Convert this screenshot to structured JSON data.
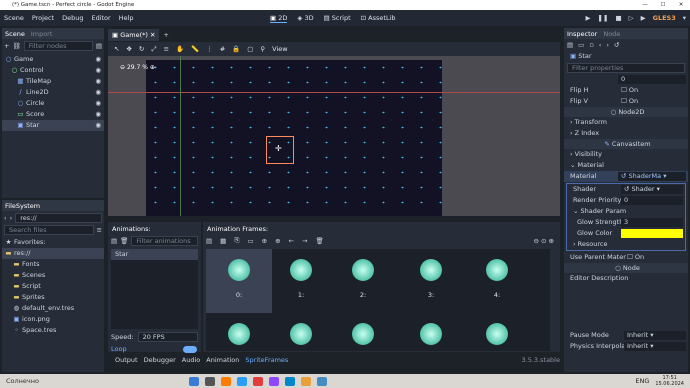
{
  "title": "(*) Game.tscn - Perfect circle - Godot Engine",
  "menu": [
    "Scene",
    "Project",
    "Debug",
    "Editor",
    "Help"
  ],
  "workspaces": [
    "2D",
    "3D",
    "Script",
    "AssetLib"
  ],
  "renderer": "GLES3",
  "scene_dock": {
    "tabs": [
      "Scene",
      "Import"
    ],
    "filter_placeholder": "Filter nodes",
    "nodes": [
      {
        "name": "Game",
        "depth": 0,
        "icon": "node2d-icon"
      },
      {
        "name": "Control",
        "depth": 1,
        "icon": "control-icon"
      },
      {
        "name": "TileMap",
        "depth": 2,
        "icon": "tilemap-icon"
      },
      {
        "name": "Line2D",
        "depth": 2,
        "icon": "line2d-icon"
      },
      {
        "name": "Circle",
        "depth": 2,
        "icon": "node2d-icon"
      },
      {
        "name": "Score",
        "depth": 2,
        "icon": "label-icon"
      },
      {
        "name": "Star",
        "depth": 2,
        "icon": "sprite-icon"
      }
    ]
  },
  "filesystem": {
    "tab": "FileSystem",
    "path": "res://",
    "search_placeholder": "Search files",
    "favorites": "Favorites:",
    "items": [
      "res://",
      "Fonts",
      "Scenes",
      "Script",
      "Sprites",
      "default_env.tres",
      "icon.png",
      "Space.tres"
    ]
  },
  "editor_tab": "Game(*)",
  "view_button": "View",
  "zoom": "29.7 %",
  "animations": {
    "header": "Animations:",
    "filter_placeholder": "Filter animations",
    "list": [
      "Star"
    ],
    "speed_label": "Speed:",
    "speed_value": "20 FPS",
    "loop_label": "Loop"
  },
  "frames": {
    "header": "Animation Frames:",
    "labels": [
      "0:",
      "1:",
      "2:",
      "3:",
      "4:"
    ]
  },
  "bottom_tabs": [
    "Output",
    "Debugger",
    "Audio",
    "Animation",
    "SpriteFrames"
  ],
  "version": "3.5.3.stable",
  "inspector": {
    "tabs": [
      "Inspector",
      "Node"
    ],
    "object": "Star",
    "filter_placeholder": "Filter properties",
    "frame_value": "0",
    "flip_h": "Flip H",
    "flip_v": "Flip V",
    "on": "On",
    "node2d": "Node2D",
    "transform": "Transform",
    "z_index": "Z Index",
    "canvasitem": "CanvasItem",
    "visibility": "Visibility",
    "material_section": "Material",
    "material_label": "Material",
    "material_value": "ShaderMa",
    "shader_label": "Shader",
    "shader_value": "Shader",
    "render_priority_label": "Render Priority",
    "render_priority_value": "0",
    "shader_param": "Shader Param",
    "glow_strength_label": "Glow Strength",
    "glow_strength_value": "3",
    "glow_color_label": "Glow Color",
    "glow_color": "#ffff00",
    "resource": "Resource",
    "use_parent_material": "Use Parent Mater",
    "node_section": "Node",
    "editor_description": "Editor Description",
    "pause_mode_label": "Pause Mode",
    "pause_mode_value": "Inherit",
    "physics_label": "Physics Interpolati",
    "physics_value": "Inherit"
  },
  "taskbar": {
    "weather": "Солнечно",
    "lang": "ENG",
    "time": "17:51",
    "date": "15.06.2024"
  }
}
